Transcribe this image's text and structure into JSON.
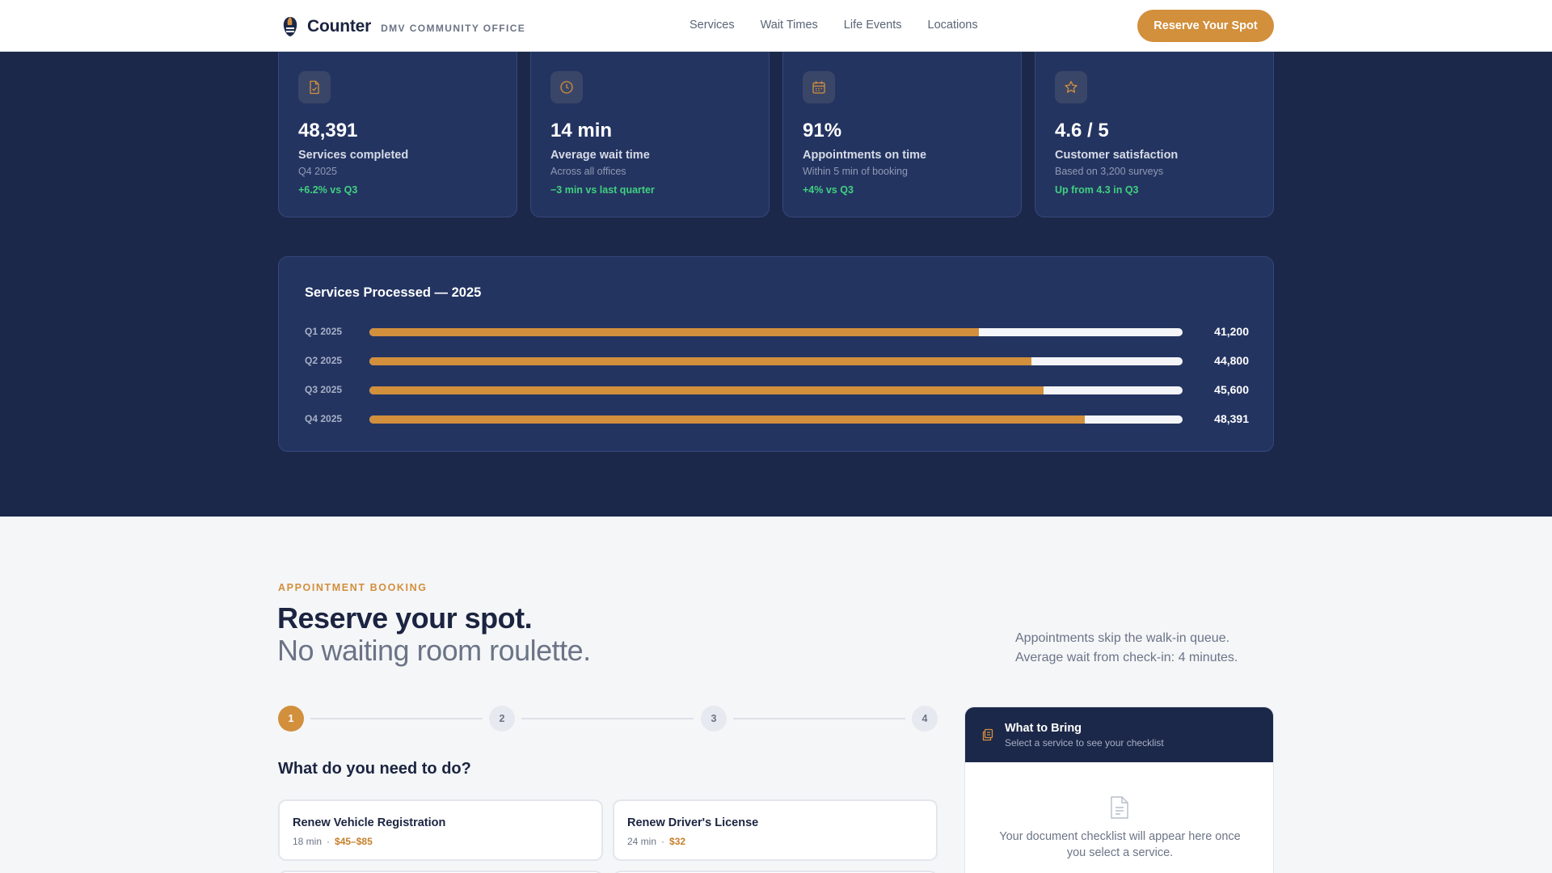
{
  "header": {
    "brand_name": "Counter",
    "brand_sub": "DMV COMMUNITY OFFICE",
    "nav": [
      "Services",
      "Wait Times",
      "Life Events",
      "Locations"
    ],
    "cta_label": "Reserve Your Spot"
  },
  "stats": [
    {
      "icon": "document-check-icon",
      "value": "48,391",
      "label": "Services completed",
      "sub": "Q4 2025",
      "delta": "+6.2% vs Q3"
    },
    {
      "icon": "clock-icon",
      "value": "14 min",
      "label": "Average wait time",
      "sub": "Across all offices",
      "delta": "−3 min vs last quarter"
    },
    {
      "icon": "calendar-icon",
      "value": "91%",
      "label": "Appointments on time",
      "sub": "Within 5 min of booking",
      "delta": "+4% vs Q3"
    },
    {
      "icon": "star-icon",
      "value": "4.6 / 5",
      "label": "Customer satisfaction",
      "sub": "Based on 3,200 surveys",
      "delta": "Up from 4.3 in Q3"
    }
  ],
  "chart_data": {
    "type": "bar",
    "title": "Services Processed — 2025",
    "categories": [
      "Q1 2025",
      "Q2 2025",
      "Q3 2025",
      "Q4 2025"
    ],
    "values": [
      41200,
      44800,
      45600,
      48391
    ],
    "value_labels": [
      "41,200",
      "44,800",
      "45,600",
      "48,391"
    ],
    "xlim": [
      0,
      55000
    ],
    "orientation": "horizontal"
  },
  "booking": {
    "eyebrow": "APPOINTMENT BOOKING",
    "title": "Reserve your spot.",
    "subtitle": "No waiting room roulette.",
    "intro_line1": "Appointments skip the walk-in queue.",
    "intro_line2": "Average wait from check-in: 4 minutes.",
    "steps": [
      "1",
      "2",
      "3",
      "4"
    ],
    "active_step": 1,
    "question": "What do you need to do?",
    "services": [
      {
        "name": "Renew Vehicle Registration",
        "duration": "18 min",
        "price": "$45–$85"
      },
      {
        "name": "Renew Driver's License",
        "duration": "24 min",
        "price": "$32"
      }
    ]
  },
  "checklist": {
    "title": "What to Bring",
    "subtitle": "Select a service to see your checklist",
    "empty_text": "Your document checklist will appear here once you select a service."
  },
  "colors": {
    "accent": "#d28f3c",
    "navy": "#1c2849",
    "card": "#243461",
    "positive": "#3fd17f"
  }
}
